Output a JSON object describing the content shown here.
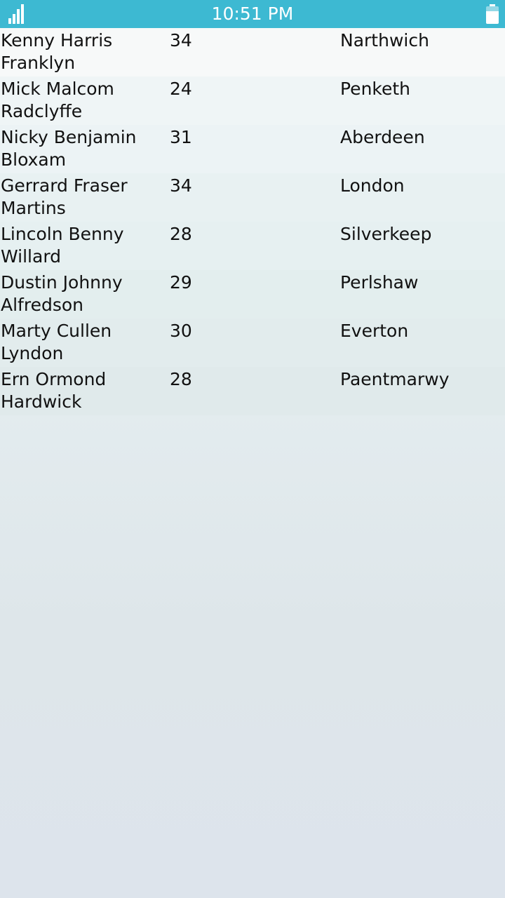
{
  "status_bar": {
    "time": "10:51 PM",
    "battery_level": 0.7,
    "signal_bars": 4
  },
  "rows": [
    {
      "name": "Kenny Harris Franklyn",
      "age": "34",
      "city": "Narthwich"
    },
    {
      "name": "Mick Malcom Radclyffe",
      "age": "24",
      "city": "Penketh"
    },
    {
      "name": "Nicky Benjamin Bloxam",
      "age": "31",
      "city": "Aberdeen"
    },
    {
      "name": "Gerrard Fraser Martins",
      "age": "34",
      "city": "London"
    },
    {
      "name": "Lincoln Benny Willard",
      "age": "28",
      "city": "Silverkeep"
    },
    {
      "name": "Dustin Johnny Alfredson",
      "age": "29",
      "city": "Perlshaw"
    },
    {
      "name": "Marty Cullen Lyndon",
      "age": "30",
      "city": "Everton"
    },
    {
      "name": "Ern Ormond Hardwick",
      "age": "28",
      "city": "Paentmarwy"
    }
  ],
  "colors": {
    "status_bar": "#3db9d2",
    "text": "#111111"
  }
}
